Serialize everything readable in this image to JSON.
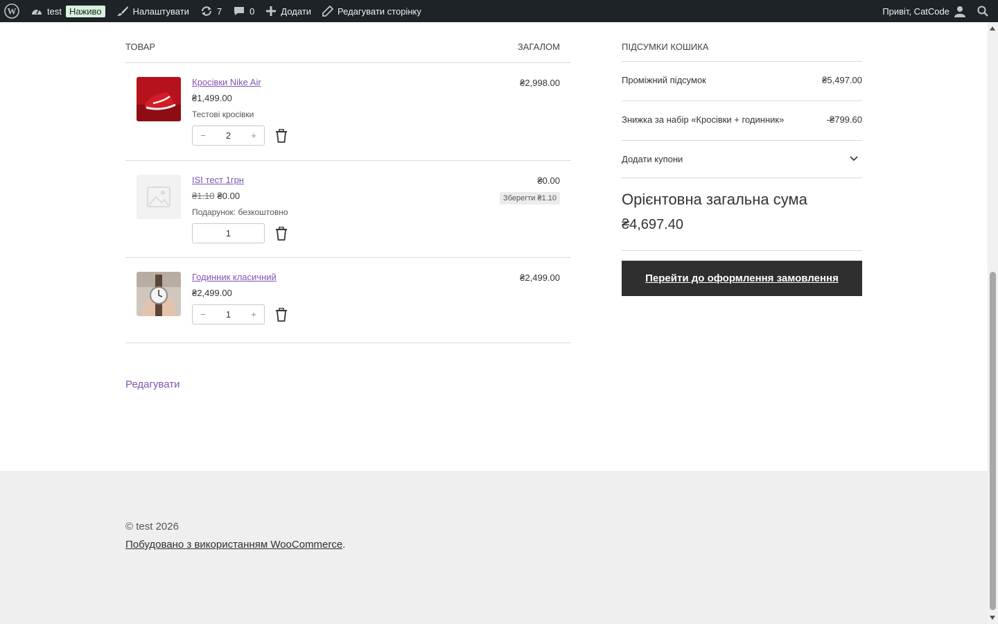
{
  "adminbar": {
    "site_name": "test",
    "live_badge": "Наживо",
    "customize": "Налаштувати",
    "updates_count": "7",
    "comments_count": "0",
    "add_new": "Додати",
    "edit_page": "Редагувати сторінку",
    "greeting": "Привіт, CatCode"
  },
  "cart": {
    "col_product": "ТОВАР",
    "col_total": "ЗАГАЛОМ",
    "items": [
      {
        "name": "Кросівки Nike Air",
        "price": "₴1,499.00",
        "meta": "Тестові кросівки",
        "qty": "2",
        "minus": "−",
        "plus": "+",
        "line_total": "₴2,998.00",
        "thumb_color": "#b5121b"
      },
      {
        "name": "ISI тест 1грн",
        "old_price": "₴1.10",
        "price": "₴0.00",
        "meta": "Подарунок: безкоштовно",
        "qty": "1",
        "line_total": "₴0.00",
        "save_badge": "Зберегти ₴1.10"
      },
      {
        "name": "Годинник класичний",
        "price": "₴2,499.00",
        "qty": "1",
        "minus": "−",
        "plus": "+",
        "line_total": "₴2,499.00"
      }
    ],
    "edit_link": "Редагувати"
  },
  "totals": {
    "heading": "ПІДСУМКИ КОШИКА",
    "subtotal_label": "Проміжний підсумок",
    "subtotal_value": "₴5,497.00",
    "discount_label": "Знижка за набір «Кросівки + годинник»",
    "discount_value": "-₴799.60",
    "coupon_label": "Додати купони",
    "estimated_label": "Орієнтовна загальна сума",
    "estimated_value": "₴4,697.40",
    "checkout_button": "Перейти до оформлення замовлення"
  },
  "footer": {
    "copyright": "© test 2026",
    "built_with": "Побудовано з використанням WooCommerce",
    "period": "."
  },
  "colors": {
    "admin_bar": "#1d2327",
    "link": "#7f54b3",
    "checkout_bg": "#2f2f2f",
    "footer_bg": "#efefef"
  }
}
